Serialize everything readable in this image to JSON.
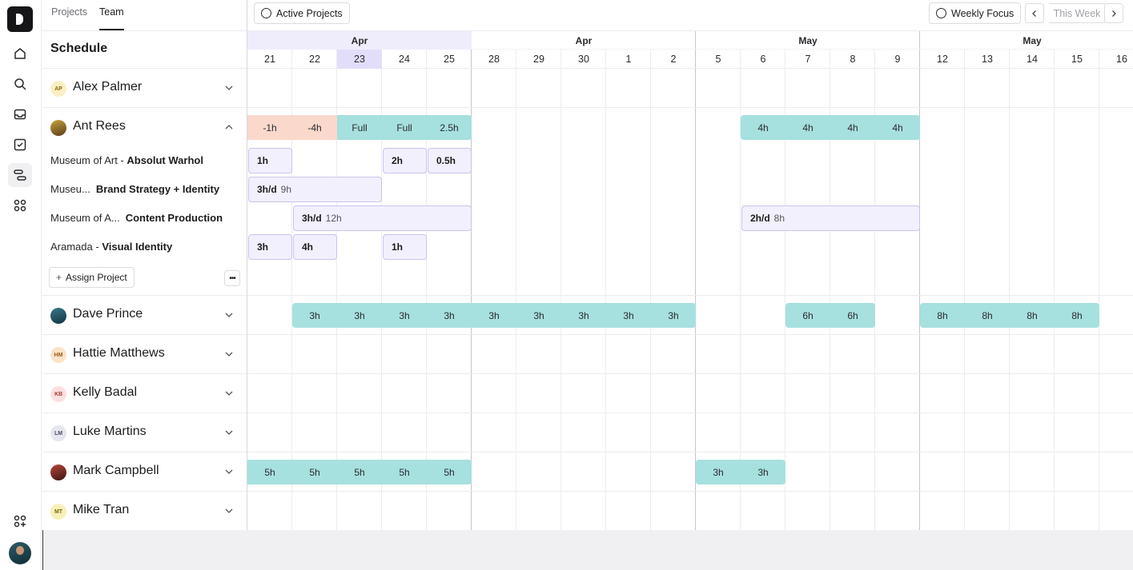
{
  "rail": {
    "items": [
      "home-icon",
      "search-icon",
      "inbox-icon",
      "tasks-icon",
      "schedule-icon",
      "apps-icon"
    ],
    "bottom": [
      "add-apps-icon"
    ]
  },
  "tabs": [
    {
      "label": "Projects"
    },
    {
      "label": "Team"
    }
  ],
  "schedule_title": "Schedule",
  "topbar": {
    "active_projects": "Active Projects",
    "weekly_focus": "Weekly Focus",
    "this_week": "This Week"
  },
  "months": [
    "Apr",
    "Apr",
    "May",
    "May"
  ],
  "days": [
    "21",
    "22",
    "23",
    "24",
    "25",
    "28",
    "29",
    "30",
    "1",
    "2",
    "5",
    "6",
    "7",
    "8",
    "9",
    "12",
    "13",
    "14",
    "15",
    "16"
  ],
  "people": [
    {
      "initials": "AP",
      "name": "Alex Palmer"
    },
    {
      "initials": "",
      "name": "Ant Rees"
    },
    {
      "initials": "",
      "name": "Dave Prince"
    },
    {
      "initials": "HM",
      "name": "Hattie Matthews"
    },
    {
      "initials": "KB",
      "name": "Kelly Badal"
    },
    {
      "initials": "LM",
      "name": "Luke Martins"
    },
    {
      "initials": "",
      "name": "Mark Campbell"
    },
    {
      "initials": "MT",
      "name": "Mike Tran"
    }
  ],
  "projects": [
    {
      "client": "Museum of Art - ",
      "name": "Absolut Warhol"
    },
    {
      "client": "Museu...",
      "name": "Brand Strategy + Identity"
    },
    {
      "client": "Museum of A...",
      "name": "Content Production"
    },
    {
      "client": "Aramada - ",
      "name": "Visual Identity"
    }
  ],
  "assign_label": "Assign Project",
  "more_label": "•••",
  "ant_summary": [
    "-1h",
    "-4h",
    "Full",
    "Full",
    "2.5h",
    "4h",
    "4h",
    "4h",
    "4h"
  ],
  "tasks": {
    "warhol": [
      "1h",
      "2h",
      "0.5h"
    ],
    "brand": {
      "rate": "3h/d",
      "total": "9h"
    },
    "content1": {
      "rate": "3h/d",
      "total": "12h"
    },
    "content2": {
      "rate": "2h/d",
      "total": "8h"
    },
    "visual": [
      "3h",
      "4h",
      "1h"
    ]
  },
  "dave": [
    "3h",
    "3h",
    "3h",
    "3h",
    "3h",
    "3h",
    "3h",
    "3h",
    "3h",
    "6h",
    "6h",
    "8h",
    "8h",
    "8h",
    "8h"
  ],
  "mark": [
    "5h",
    "5h",
    "5h",
    "5h",
    "5h",
    "3h",
    "3h"
  ]
}
